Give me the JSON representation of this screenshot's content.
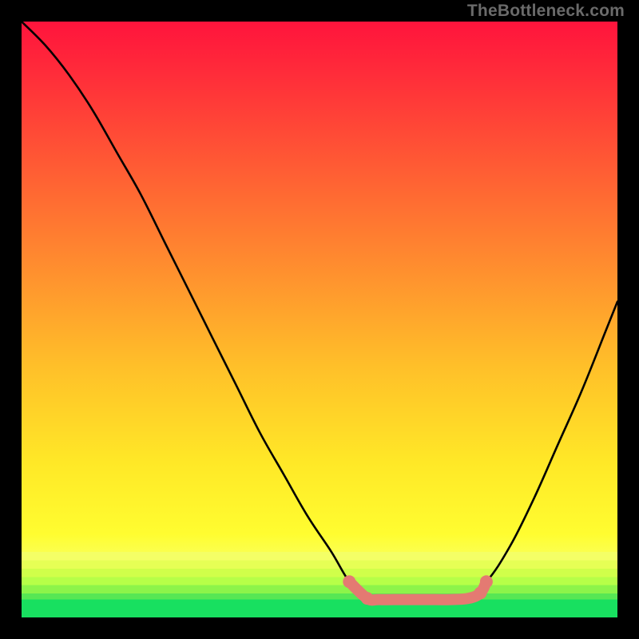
{
  "watermark": "TheBottleneck.com",
  "chart_data": {
    "type": "line",
    "title": "",
    "xlabel": "",
    "ylabel": "",
    "xlim": [
      0,
      100
    ],
    "ylim": [
      0,
      100
    ],
    "series": [
      {
        "name": "curve",
        "x": [
          0,
          4,
          8,
          12,
          16,
          20,
          24,
          28,
          32,
          36,
          40,
          44,
          48,
          52,
          55,
          58,
          62,
          66,
          70,
          74,
          78,
          82,
          86,
          90,
          94,
          98,
          100
        ],
        "y": [
          100,
          96,
          91,
          85,
          78,
          71,
          63,
          55,
          47,
          39,
          31,
          24,
          17,
          11,
          6,
          3,
          3,
          3,
          3,
          3,
          6,
          12,
          20,
          29,
          38,
          48,
          53
        ]
      },
      {
        "name": "floor-highlight",
        "x": [
          55,
          58,
          60,
          64,
          68,
          72,
          75,
          77,
          78
        ],
        "y": [
          6,
          3.2,
          3,
          3,
          3,
          3,
          3.2,
          4.1,
          6
        ]
      }
    ],
    "gradient": {
      "stops": [
        {
          "pos": 0.0,
          "color": "#ff143c"
        },
        {
          "pos": 0.4,
          "color": "#ff8a2f"
        },
        {
          "pos": 0.86,
          "color": "#fffd30"
        },
        {
          "pos": 0.97,
          "color": "#57e754"
        },
        {
          "pos": 1.0,
          "color": "#18e060"
        }
      ]
    },
    "highlight_color": "#e47a72",
    "annotations": []
  }
}
